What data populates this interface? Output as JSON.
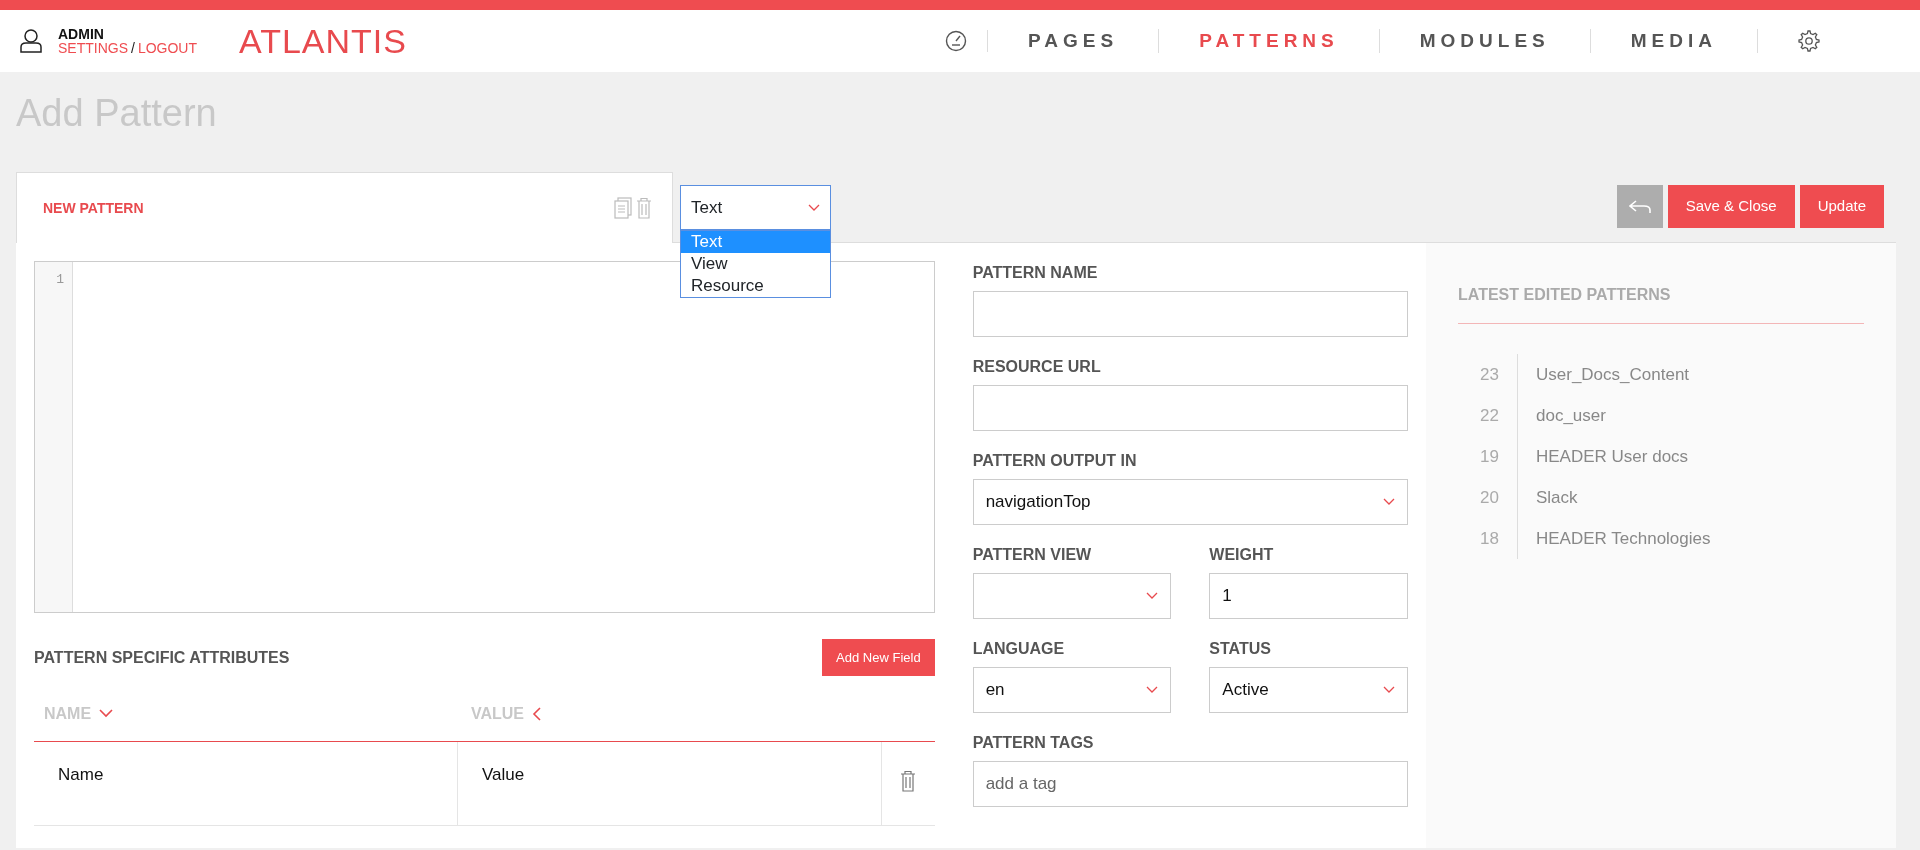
{
  "user": {
    "name": "ADMIN",
    "links": [
      "SETTINGS",
      "LOGOUT"
    ],
    "separator": "/"
  },
  "logo": "ATLANTIS",
  "nav": [
    {
      "kind": "dashboard",
      "selected": false
    },
    {
      "kind": "text",
      "label": "PAGES",
      "selected": false
    },
    {
      "kind": "text",
      "label": "PATTERNS",
      "selected": true
    },
    {
      "kind": "text",
      "label": "MODULES",
      "selected": false
    },
    {
      "kind": "text",
      "label": "MEDIA",
      "selected": false
    },
    {
      "kind": "settings",
      "selected": false
    }
  ],
  "page_title": "Add Pattern",
  "tab": {
    "label": "NEW PATTERN"
  },
  "type_select": {
    "value": "Text",
    "expanded": true,
    "options": [
      {
        "label": "Text",
        "selected": true
      },
      {
        "label": "View",
        "selected": false
      },
      {
        "label": "Resource",
        "selected": false
      }
    ]
  },
  "buttons": [
    {
      "kind": "back"
    },
    {
      "kind": "text",
      "label": "Save & Close"
    },
    {
      "kind": "text",
      "label": "Update"
    }
  ],
  "editor": {
    "line_numbers": [
      "1"
    ]
  },
  "attributes": {
    "title": "PATTERN SPECIFIC ATTRIBUTES",
    "add_button": "Add New Field",
    "columns": [
      {
        "label": "NAME",
        "sorted": true
      },
      {
        "label": "VALUE",
        "sorted": false
      }
    ],
    "rows": [
      {
        "name": "Name",
        "value": "Value"
      }
    ]
  },
  "form": [
    [
      {
        "label": "PATTERN NAME",
        "kind": "text"
      }
    ],
    [
      {
        "label": "RESOURCE URL",
        "kind": "text"
      }
    ],
    [
      {
        "label": "PATTERN OUTPUT IN",
        "kind": "select",
        "value": "navigationTop"
      }
    ],
    [
      {
        "label": "PATTERN VIEW",
        "kind": "select"
      },
      {
        "label": "WEIGHT",
        "kind": "text",
        "value": "1"
      }
    ],
    [
      {
        "label": "LANGUAGE",
        "kind": "select",
        "value": "en"
      },
      {
        "label": "STATUS",
        "kind": "select",
        "value": "Active"
      }
    ],
    [
      {
        "label": "PATTERN TAGS",
        "kind": "text",
        "placeholder": "add a tag"
      }
    ]
  ],
  "latest": {
    "title": "LATEST EDITED PATTERNS",
    "items": [
      {
        "id": "23",
        "name": "User_Docs_Content"
      },
      {
        "id": "22",
        "name": "doc_user"
      },
      {
        "id": "19",
        "name": "HEADER User docs"
      },
      {
        "id": "20",
        "name": "Slack"
      },
      {
        "id": "18",
        "name": "HEADER Technologies"
      }
    ]
  }
}
